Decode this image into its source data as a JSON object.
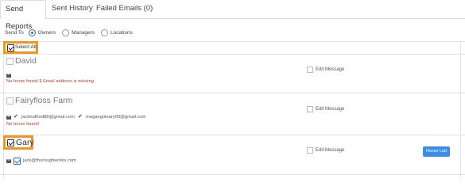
{
  "tabs": [
    {
      "label": "Send Reports",
      "active": true
    },
    {
      "label": "Sent History",
      "active": false
    },
    {
      "label": "Failed Emails (0)",
      "active": false
    }
  ],
  "send_to": {
    "label": "Send To",
    "options": [
      {
        "label": "Owners",
        "selected": true
      },
      {
        "label": "Managers",
        "selected": false
      },
      {
        "label": "Locations",
        "selected": false
      }
    ]
  },
  "select_all": {
    "label": "Select All",
    "checked": true
  },
  "owners": [
    {
      "name": "David",
      "checked": false,
      "errors": [
        "No horse found",
        "Email address is missing."
      ],
      "edit_message_label": "Edit Message"
    },
    {
      "name": "Fairyfloss Farm",
      "checked": false,
      "emails": [
        "jackhalford88@gmail.com",
        "megangoleary00@gmail.com"
      ],
      "errors": [
        "No horse found!"
      ],
      "edit_message_label": "Edit Message"
    },
    {
      "name": "Gary",
      "checked": true,
      "emails": [
        "jack@thoroughworks.com"
      ],
      "edit_message_label": "Edit Message",
      "action_label": "Horse List"
    }
  ],
  "colors": {
    "accent": "#2b6cd4",
    "highlight": "#f7941d",
    "error": "#c0392b",
    "button": "#3a8ee6"
  }
}
